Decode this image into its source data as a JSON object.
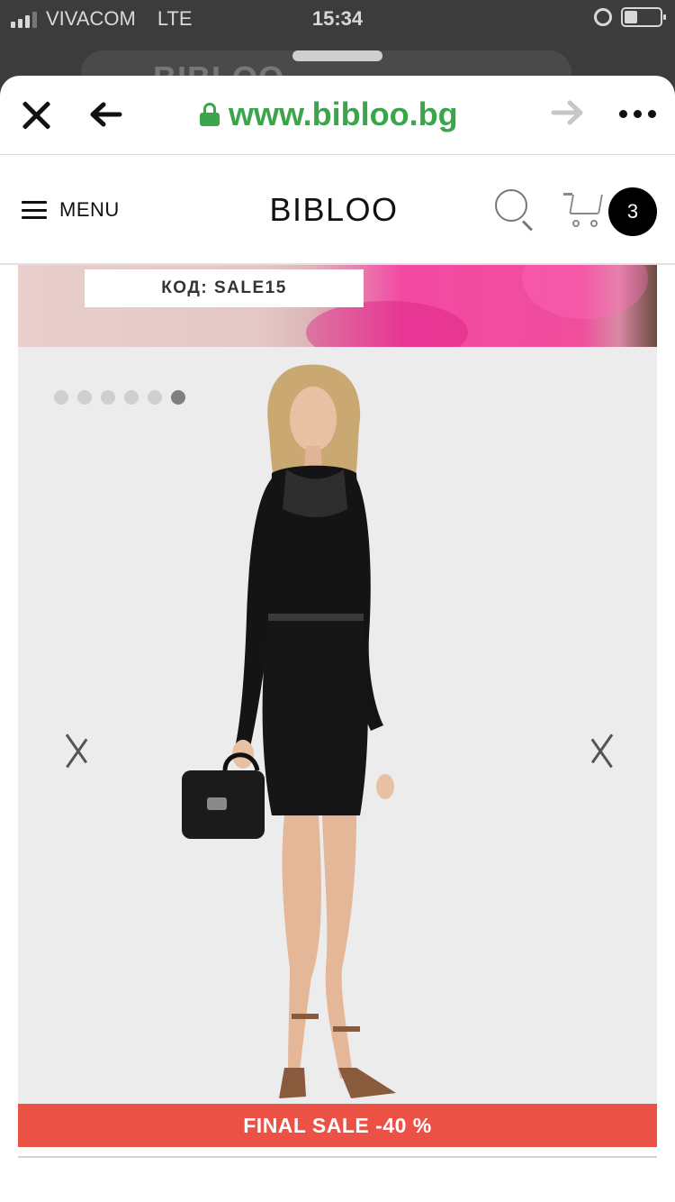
{
  "status_bar": {
    "carrier": "VIVACOM",
    "network": "LTE",
    "time": "15:34"
  },
  "background_tab": {
    "text": "BIBLOO"
  },
  "browser": {
    "url": "www.bibloo.bg",
    "back_icon": "arrow-left-icon",
    "forward_icon": "arrow-right-icon",
    "close_icon": "close-icon",
    "more_icon": "more-icon",
    "secure_color": "#3aa54b"
  },
  "header": {
    "menu_label": "MENU",
    "logo": "BIBLOO",
    "cart_count": "3"
  },
  "promo": {
    "code_text": "КОД: SALE15"
  },
  "gallery": {
    "image_count": 6,
    "active_index": 6
  },
  "product": {
    "sale_label": "FINAL SALE -40 %",
    "sale_color": "#ec5146"
  }
}
